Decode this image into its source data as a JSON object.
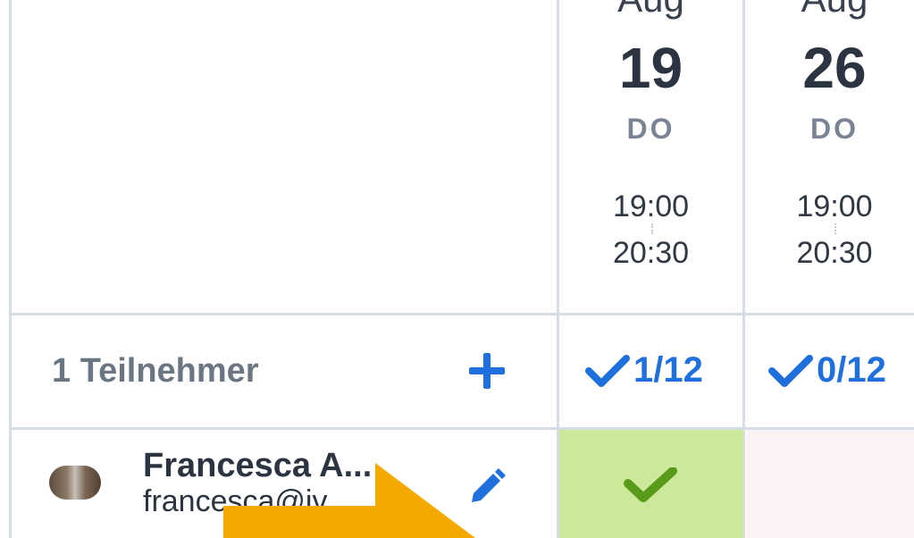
{
  "dates": [
    {
      "month": "Aug",
      "day": "19",
      "weekday": "DO",
      "start": "19:00",
      "end": "20:30",
      "count": "1/12"
    },
    {
      "month": "Aug",
      "day": "26",
      "weekday": "DO",
      "start": "19:00",
      "end": "20:30",
      "count": "0/12"
    }
  ],
  "participants": {
    "label": "1 Teilnehmer"
  },
  "person": {
    "name": "Francesca A...",
    "email": "francesca@iv..."
  },
  "colors": {
    "accent": "#1f6fdc",
    "yes_cell": "#cce89a",
    "no_cell": "#fbf3f3",
    "check": "#5a9a1b",
    "arrow": "#f5a800"
  },
  "icons": {
    "add": "plus-icon",
    "check": "check-icon",
    "edit": "pencil-icon"
  }
}
